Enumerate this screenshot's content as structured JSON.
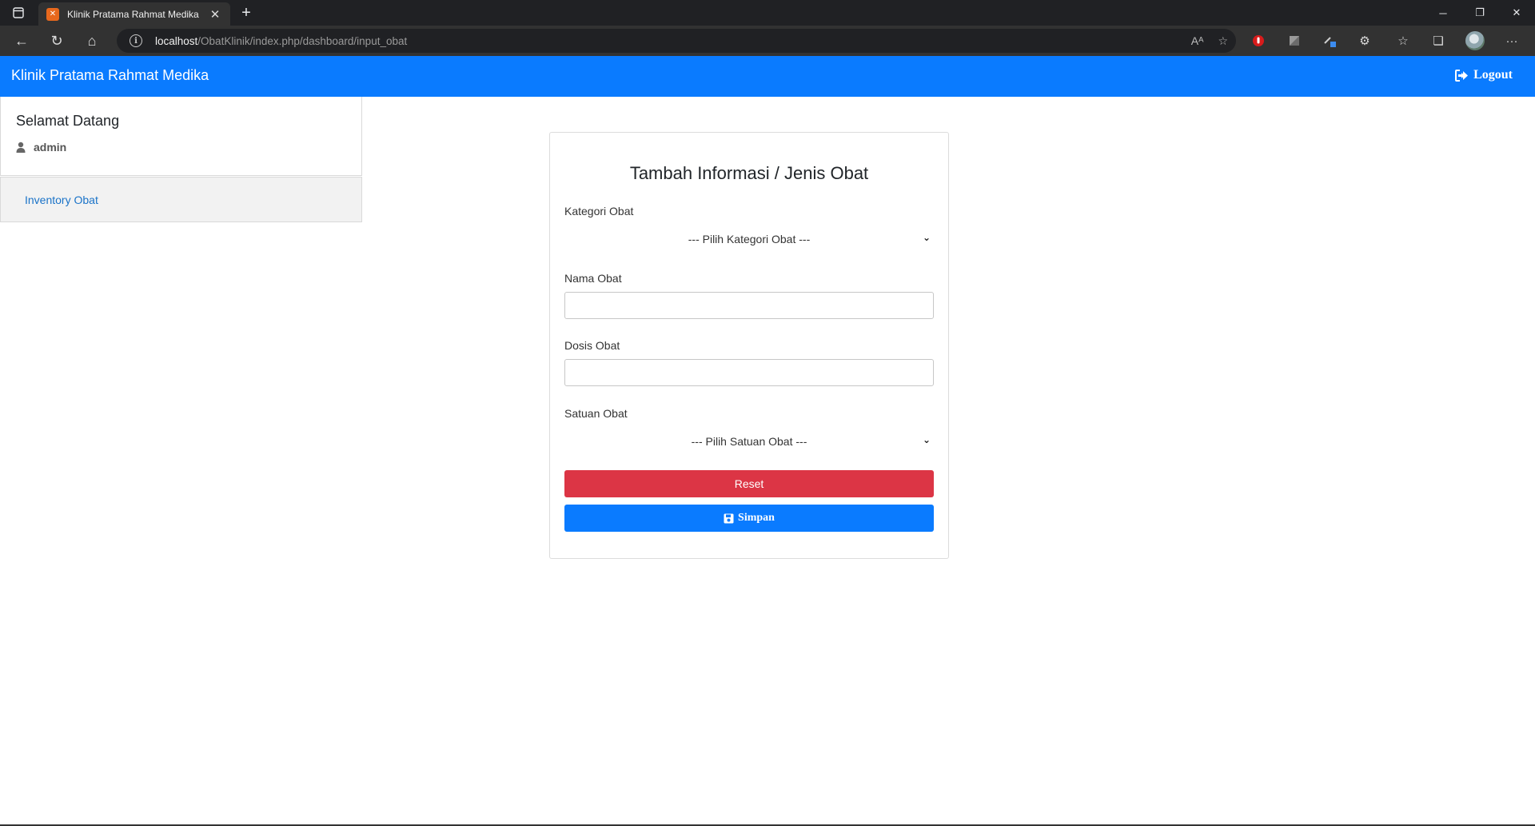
{
  "browser": {
    "tab_title": "Klinik Pratama Rahmat Medika",
    "new_tab_label": "+",
    "url_host": "localhost",
    "url_path": "/ObatKlinik/index.php/dashboard/input_obat"
  },
  "navbar": {
    "brand": "Klinik Pratama Rahmat Medika",
    "logout_label": "Logout",
    "color": "#0a7bff"
  },
  "sidebar": {
    "welcome": "Selamat Datang",
    "username": "admin",
    "menu_items": [
      {
        "label": "Inventory Obat"
      }
    ]
  },
  "form": {
    "title": "Tambah Informasi / Jenis Obat",
    "kategori_label": "Kategori Obat",
    "kategori_selected": "--- Pilih Kategori Obat ---",
    "nama_label": "Nama Obat",
    "nama_value": "",
    "dosis_label": "Dosis Obat",
    "dosis_value": "",
    "satuan_label": "Satuan Obat",
    "satuan_selected": "--- Pilih Satuan Obat ---",
    "reset_label": "Reset",
    "save_label": "Simpan",
    "reset_color": "#dc3545",
    "save_color": "#0a7bff"
  },
  "icons": [
    "sidebar-toggle-icon",
    "xampp-favicon-icon",
    "close-icon",
    "back-icon",
    "reload-icon",
    "home-icon",
    "info-icon",
    "read-aloud-icon",
    "favorite-add-icon",
    "extension-icon",
    "favorites-icon",
    "collections-icon",
    "profile-avatar-icon",
    "more-icon",
    "sign-out-icon",
    "user-icon",
    "chevron-down-icon",
    "save-icon"
  ]
}
